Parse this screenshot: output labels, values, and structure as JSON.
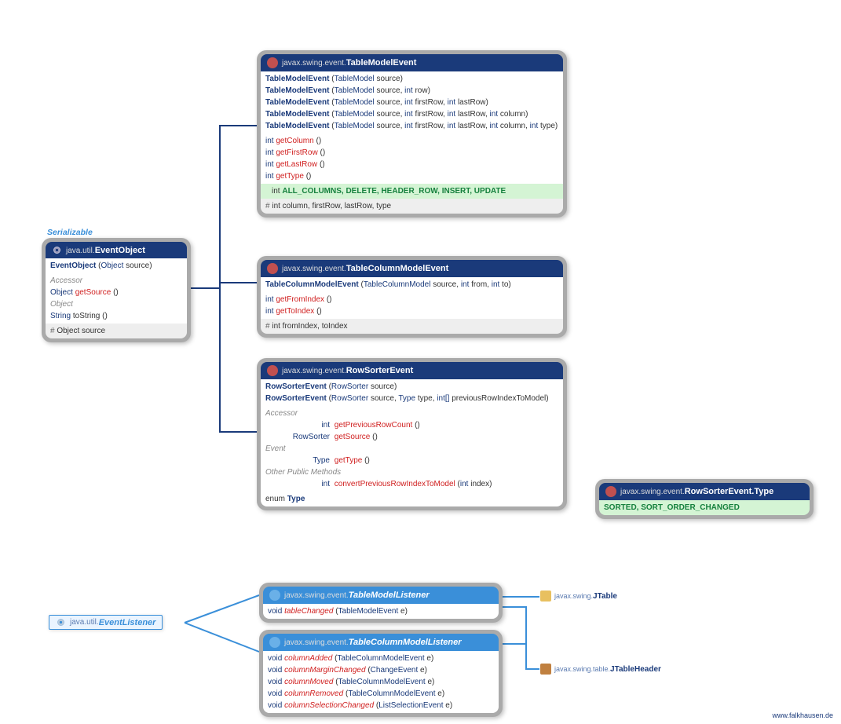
{
  "serializable_label": "Serializable",
  "event_object": {
    "package": "java.util.",
    "name": "EventObject",
    "ctors": [
      {
        "name": "EventObject",
        "params": [
          {
            "type": "Object",
            "name": "source"
          }
        ]
      }
    ],
    "accessor_label": "Accessor",
    "accessor": [
      {
        "ret": "Object",
        "name": "getSource",
        "params": "()"
      }
    ],
    "object_label": "Object",
    "object_methods": [
      {
        "ret": "String",
        "name": "toString",
        "params": "()"
      }
    ],
    "fields": "Object source"
  },
  "table_model_event": {
    "package": "javax.swing.event.",
    "name": "TableModelEvent",
    "ctors": [
      {
        "name": "TableModelEvent",
        "params": [
          {
            "type": "TableModel",
            "name": "source"
          }
        ]
      },
      {
        "name": "TableModelEvent",
        "params": [
          {
            "type": "TableModel",
            "name": "source"
          },
          {
            "type": "int",
            "name": "row"
          }
        ]
      },
      {
        "name": "TableModelEvent",
        "params": [
          {
            "type": "TableModel",
            "name": "source"
          },
          {
            "type": "int",
            "name": "firstRow"
          },
          {
            "type": "int",
            "name": "lastRow"
          }
        ]
      },
      {
        "name": "TableModelEvent",
        "params": [
          {
            "type": "TableModel",
            "name": "source"
          },
          {
            "type": "int",
            "name": "firstRow"
          },
          {
            "type": "int",
            "name": "lastRow"
          },
          {
            "type": "int",
            "name": "column"
          }
        ]
      },
      {
        "name": "TableModelEvent",
        "params": [
          {
            "type": "TableModel",
            "name": "source"
          },
          {
            "type": "int",
            "name": "firstRow"
          },
          {
            "type": "int",
            "name": "lastRow"
          },
          {
            "type": "int",
            "name": "column"
          },
          {
            "type": "int",
            "name": "type"
          }
        ]
      }
    ],
    "methods": [
      {
        "ret": "int",
        "name": "getColumn",
        "params": "()"
      },
      {
        "ret": "int",
        "name": "getFirstRow",
        "params": "()"
      },
      {
        "ret": "int",
        "name": "getLastRow",
        "params": "()"
      },
      {
        "ret": "int",
        "name": "getType",
        "params": "()"
      }
    ],
    "constants_type": "int",
    "constants": "ALL_COLUMNS, DELETE, HEADER_ROW, INSERT, UPDATE",
    "fields": "int column, firstRow, lastRow, type"
  },
  "table_column_model_event": {
    "package": "javax.swing.event.",
    "name": "TableColumnModelEvent",
    "ctors": [
      {
        "name": "TableColumnModelEvent",
        "params": [
          {
            "type": "TableColumnModel",
            "name": "source"
          },
          {
            "type": "int",
            "name": "from"
          },
          {
            "type": "int",
            "name": "to"
          }
        ]
      }
    ],
    "methods": [
      {
        "ret": "int",
        "name": "getFromIndex",
        "params": "()"
      },
      {
        "ret": "int",
        "name": "getToIndex",
        "params": "()"
      }
    ],
    "fields": "int fromIndex, toIndex"
  },
  "row_sorter_event": {
    "package": "javax.swing.event.",
    "name": "RowSorterEvent",
    "ctors": [
      {
        "name": "RowSorterEvent",
        "params": [
          {
            "type": "RowSorter<?>",
            "name": "source"
          }
        ]
      },
      {
        "name": "RowSorterEvent",
        "params": [
          {
            "type": "RowSorter<?>",
            "name": "source"
          },
          {
            "type": "Type",
            "name": "type"
          },
          {
            "type": "int[]",
            "name": "previousRowIndexToModel"
          }
        ]
      }
    ],
    "accessor_label": "Accessor",
    "accessor": [
      {
        "ret": "int",
        "name": "getPreviousRowCount",
        "params": "()",
        "retwidth": "85px"
      },
      {
        "ret": "RowSorter<?>",
        "name": "getSource",
        "params": "()",
        "retwidth": "85px"
      }
    ],
    "event_label": "Event",
    "event_methods": [
      {
        "ret": "Type",
        "name": "getType",
        "params": "()",
        "retwidth": "85px"
      }
    ],
    "other_label": "Other Public Methods",
    "other_methods": [
      {
        "ret": "int",
        "name": "convertPreviousRowIndexToModel",
        "params": [
          {
            "type": "int",
            "name": "index"
          }
        ],
        "retwidth": "85px"
      }
    ],
    "nested_type": "enum",
    "nested_name": "Type"
  },
  "row_sorter_event_type": {
    "package": "javax.swing.event.",
    "name": "RowSorterEvent.Type",
    "constants": "SORTED, SORT_ORDER_CHANGED"
  },
  "event_listener": {
    "package": "java.util.",
    "name": "EventListener"
  },
  "table_model_listener": {
    "package": "javax.swing.event.",
    "name": "TableModelListener",
    "methods": [
      {
        "ret": "void",
        "name": "tableChanged",
        "params": [
          {
            "type": "TableModelEvent",
            "name": "e"
          }
        ]
      }
    ]
  },
  "table_column_model_listener": {
    "package": "javax.swing.event.",
    "name": "TableColumnModelListener",
    "methods": [
      {
        "ret": "void",
        "name": "columnAdded",
        "params": [
          {
            "type": "TableColumnModelEvent",
            "name": "e"
          }
        ]
      },
      {
        "ret": "void",
        "name": "columnMarginChanged",
        "params": [
          {
            "type": "ChangeEvent",
            "name": "e"
          }
        ]
      },
      {
        "ret": "void",
        "name": "columnMoved",
        "params": [
          {
            "type": "TableColumnModelEvent",
            "name": "e"
          }
        ]
      },
      {
        "ret": "void",
        "name": "columnRemoved",
        "params": [
          {
            "type": "TableColumnModelEvent",
            "name": "e"
          }
        ]
      },
      {
        "ret": "void",
        "name": "columnSelectionChanged",
        "params": [
          {
            "type": "ListSelectionEvent",
            "name": "e"
          }
        ]
      }
    ]
  },
  "jtable_ref": {
    "package": "javax.swing.",
    "name": "JTable"
  },
  "jtableheader_ref": {
    "package": "javax.swing.table.",
    "name": "JTableHeader"
  },
  "watermark": "www.falkhausen.de"
}
